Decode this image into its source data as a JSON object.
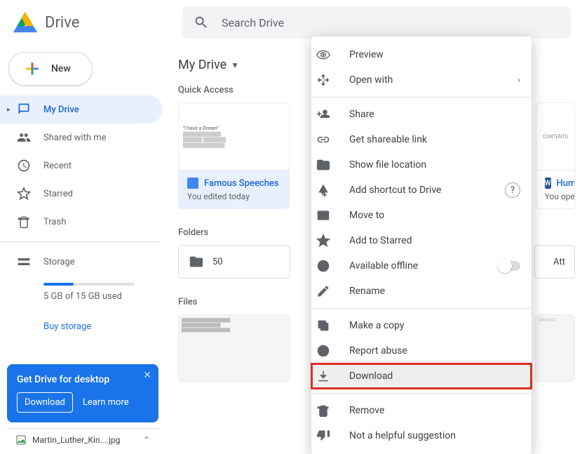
{
  "app": {
    "name": "Drive"
  },
  "search": {
    "placeholder": "Search Drive"
  },
  "sidebar": {
    "new_label": "New",
    "items": [
      {
        "label": "My Drive",
        "icon": "my-drive-icon"
      },
      {
        "label": "Shared with me",
        "icon": "shared-icon"
      },
      {
        "label": "Recent",
        "icon": "recent-icon"
      },
      {
        "label": "Starred",
        "icon": "star-icon"
      },
      {
        "label": "Trash",
        "icon": "trash-icon"
      }
    ],
    "storage_label": "Storage",
    "storage_used": "5 GB of 15 GB used",
    "buy_label": "Buy storage"
  },
  "promo": {
    "title": "Get Drive for desktop",
    "download": "Download",
    "learn": "Learn more"
  },
  "download_bar": {
    "filename": "Martin_Luther_Kin....jpg"
  },
  "main": {
    "breadcrumb": "My Drive",
    "quick_access_label": "Quick Access",
    "quick_cards": [
      {
        "title": "Famous Speeches",
        "sub": "You edited today",
        "thumb_text": "\"I have a Dream\"",
        "type": "gdoc"
      },
      {
        "title": "Huma",
        "sub": "You opened",
        "thumb_text": "CONTENTS",
        "type": "wdoc"
      }
    ],
    "folders_label": "Folders",
    "folders": [
      {
        "name": "50"
      },
      {
        "name": "Att"
      }
    ],
    "files_label": "Files",
    "files": [
      {
        "name": ""
      },
      {
        "name": "MEGAN C"
      }
    ]
  },
  "context_menu": {
    "items": [
      {
        "label": "Preview",
        "icon": "eye-icon"
      },
      {
        "label": "Open with",
        "icon": "open-with-icon",
        "trail": "›"
      },
      {
        "sep": true
      },
      {
        "label": "Share",
        "icon": "person-add-icon"
      },
      {
        "label": "Get shareable link",
        "icon": "link-icon"
      },
      {
        "label": "Show file location",
        "icon": "folder-icon"
      },
      {
        "label": "Add shortcut to Drive",
        "icon": "drive-add-icon",
        "help": true
      },
      {
        "label": "Move to",
        "icon": "move-icon"
      },
      {
        "label": "Add to Starred",
        "icon": "star-outline-icon"
      },
      {
        "label": "Available offline",
        "icon": "offline-icon",
        "toggle": true
      },
      {
        "label": "Rename",
        "icon": "pencil-icon"
      },
      {
        "sep": true
      },
      {
        "label": "Make a copy",
        "icon": "copy-icon"
      },
      {
        "label": "Report abuse",
        "icon": "report-icon"
      },
      {
        "label": "Download",
        "icon": "download-icon",
        "highlight": true
      },
      {
        "sep": true
      },
      {
        "label": "Remove",
        "icon": "trash-outline-icon"
      },
      {
        "label": "Not a helpful suggestion",
        "icon": "thumb-down-icon"
      }
    ]
  }
}
